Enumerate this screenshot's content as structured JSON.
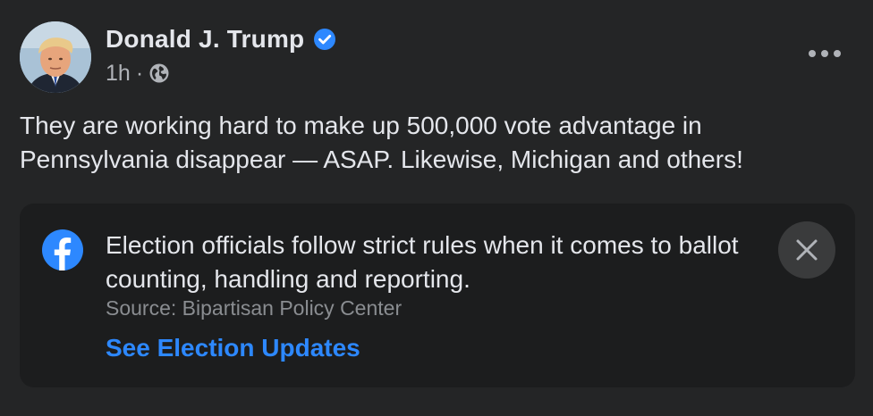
{
  "post": {
    "author_name": "Donald J. Trump",
    "timestamp": "1h",
    "separator": "·",
    "audience_icon": "globe-icon",
    "verified_icon": "verified-badge-icon",
    "more_icon": "more-options-icon",
    "text": "They are working hard to make up 500,000 vote advantage in Pennsylvania disappear — ASAP. Likewise, Michigan and others!"
  },
  "info_card": {
    "logo_icon": "facebook-logo-icon",
    "message": "Election officials follow strict rules when it comes to ballot counting, handling and reporting.",
    "source": "Source: Bipartisan Policy Center",
    "link_label": "See Election Updates",
    "close_icon": "close-icon"
  },
  "colors": {
    "background": "#242526",
    "card_background": "#1c1d1e",
    "primary_text": "#e4e6eb",
    "secondary_text": "#b0b3b8",
    "link": "#2d88ff",
    "verified": "#2d88ff",
    "close_button_bg": "#3a3b3c"
  }
}
